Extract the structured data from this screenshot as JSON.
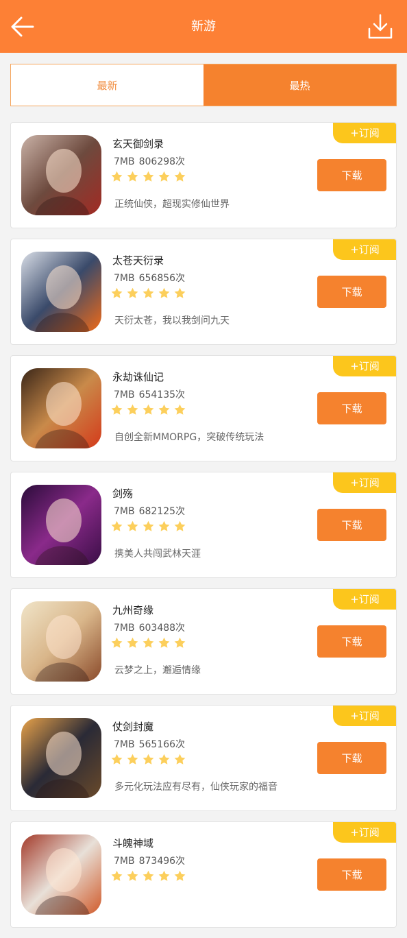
{
  "header": {
    "title": "新游"
  },
  "tabs": [
    {
      "label": "最新",
      "active": false
    },
    {
      "label": "最热",
      "active": true
    }
  ],
  "colors": {
    "accent": "#fd8035",
    "subscribe": "#fcc61c",
    "star": "#fccf5c"
  },
  "games": [
    {
      "name": "玄天御剑录",
      "size": "7MB",
      "downloads": "806298次",
      "stars": 5,
      "desc": "正统仙侠，超现实修仙世界",
      "subscribe": "+订阅",
      "download": "下载",
      "icon": "game-icon-xuantian"
    },
    {
      "name": "太苍天衍录",
      "size": "7MB",
      "downloads": "656856次",
      "stars": 5,
      "desc": "天衍太苍，我以我剑问九天",
      "subscribe": "+订阅",
      "download": "下载",
      "icon": "game-icon-taicang"
    },
    {
      "name": "永劫诛仙记",
      "size": "7MB",
      "downloads": "654135次",
      "stars": 5,
      "desc": "自创全新MMORPG，突破传统玩法",
      "subscribe": "+订阅",
      "download": "下载",
      "icon": "game-icon-yongjie"
    },
    {
      "name": "剑殇",
      "size": "7MB",
      "downloads": "682125次",
      "stars": 5,
      "desc": "携美人共闯武林天涯",
      "subscribe": "+订阅",
      "download": "下载",
      "icon": "game-icon-jianshang"
    },
    {
      "name": "九州奇缘",
      "size": "7MB",
      "downloads": "603488次",
      "stars": 5,
      "desc": "云梦之上，邂逅情缘",
      "subscribe": "+订阅",
      "download": "下载",
      "icon": "game-icon-jiuzhou"
    },
    {
      "name": "仗剑封魔",
      "size": "7MB",
      "downloads": "565166次",
      "stars": 5,
      "desc": "多元化玩法应有尽有，仙侠玩家的福音",
      "subscribe": "+订阅",
      "download": "下载",
      "icon": "game-icon-zhangjian"
    },
    {
      "name": "斗魄神域",
      "size": "7MB",
      "downloads": "873496次",
      "stars": 5,
      "desc": "",
      "subscribe": "+订阅",
      "download": "下载",
      "icon": "game-icon-doupo"
    }
  ]
}
